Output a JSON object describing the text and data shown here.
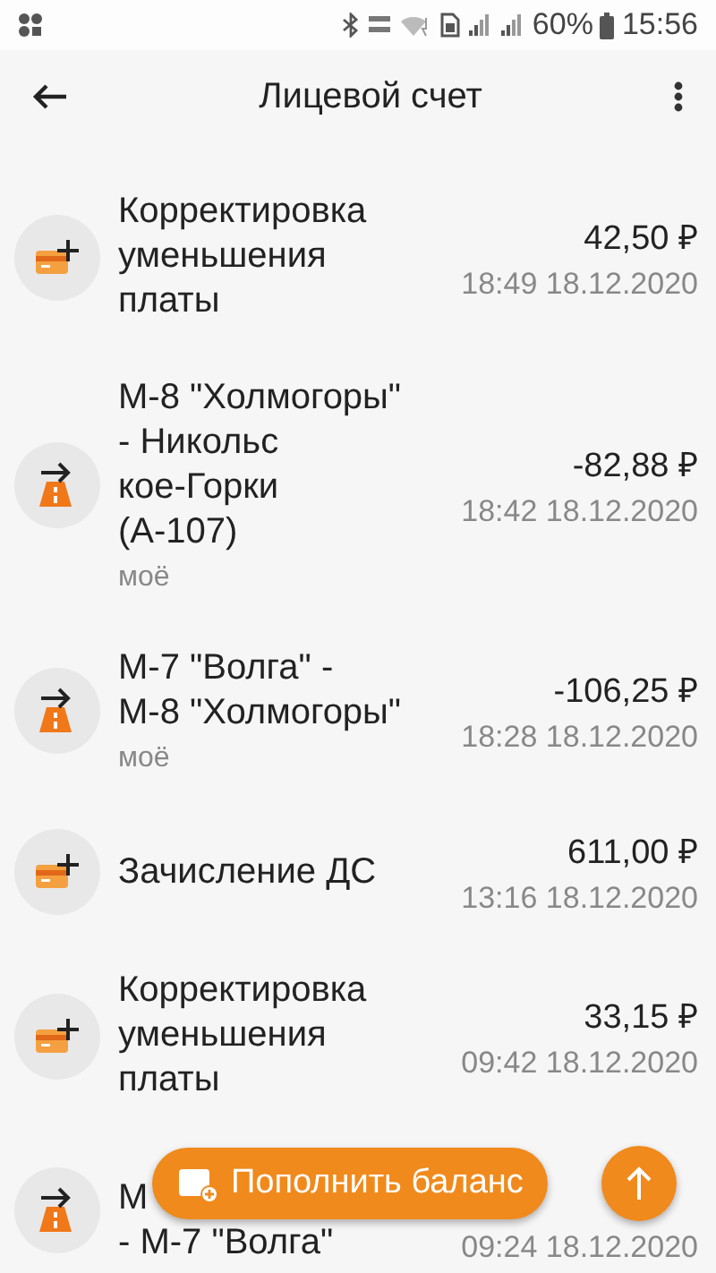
{
  "status_bar": {
    "battery": "60%",
    "time": "15:56"
  },
  "app_bar": {
    "title": "Лицевой счет"
  },
  "transactions": [
    {
      "kind": "card",
      "title": "Корректировка уменьшения платы",
      "amount": "42,50 ₽",
      "time": "18:49 18.12.2020"
    },
    {
      "kind": "road",
      "title": "М-8 \"Холмогоры\" - Никольс кое-Горки (А-107)",
      "note": "моё",
      "amount": "-82,88 ₽",
      "time": "18:42 18.12.2020"
    },
    {
      "kind": "road",
      "title": "М-7 \"Волга\" - М-8 \"Холмогоры\"",
      "note": "моё",
      "amount": "-106,25 ₽",
      "time": "18:28 18.12.2020"
    },
    {
      "kind": "card",
      "title": "Зачисление ДС",
      "amount": "611,00 ₽",
      "time": "13:16 18.12.2020"
    },
    {
      "kind": "card",
      "title": "Корректировка уменьшения платы",
      "amount": "33,15 ₽",
      "time": "09:42 18.12.2020"
    },
    {
      "kind": "road",
      "title_lines": [
        "М",
        "- М-7 \"Волга\""
      ],
      "time": "09:24 18.12.2020"
    }
  ],
  "fab": {
    "label": "Пополнить баланс"
  }
}
